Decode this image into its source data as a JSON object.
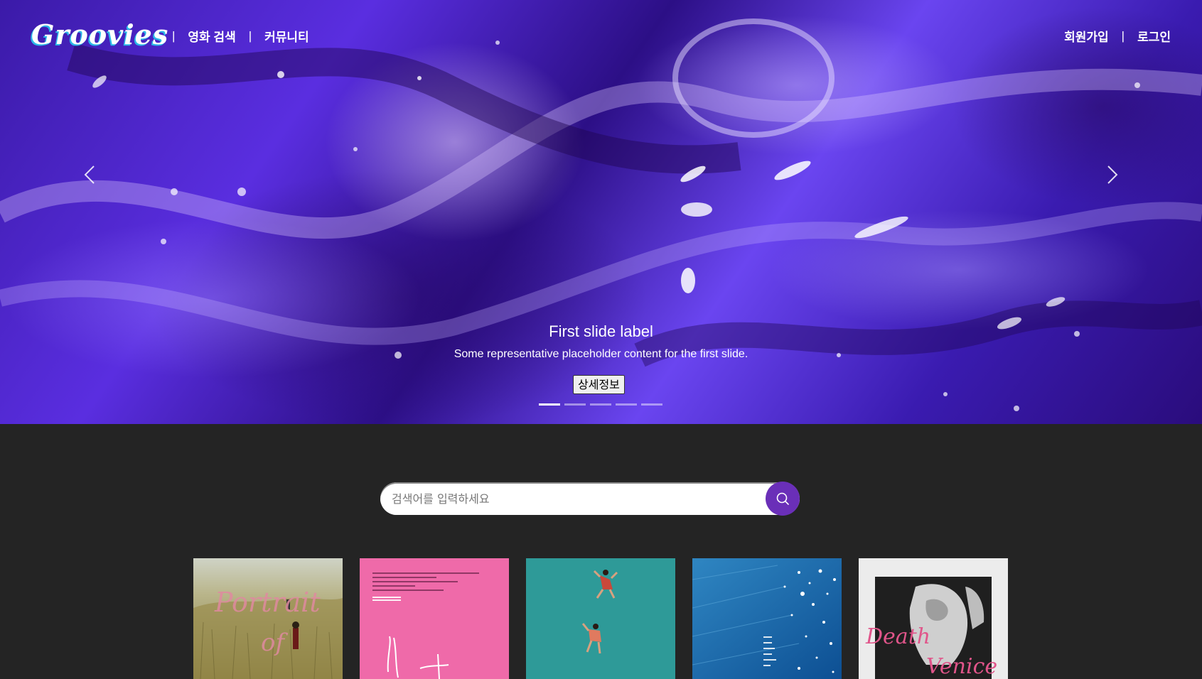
{
  "nav": {
    "logo": "Groovies",
    "left_links": [
      "영화 검색",
      "커뮤니티"
    ],
    "right_links": [
      "회원가입",
      "로그인"
    ],
    "separator": "|"
  },
  "carousel": {
    "slide_title": "First slide label",
    "slide_text": "Some representative placeholder content for the first slide.",
    "detail_button": "상세정보",
    "slide_count": 5,
    "active_index": 0,
    "accent": "#5a2ee0"
  },
  "search": {
    "placeholder": "검색어를 입력하세요",
    "button_color": "#6a2fb8"
  },
  "posters": [
    {
      "theme": "grass-field",
      "title_art": "Portrait of"
    },
    {
      "theme": "pink",
      "title_art": ""
    },
    {
      "theme": "teal-divers",
      "title_art": ""
    },
    {
      "theme": "blue-pool",
      "title_art": ""
    },
    {
      "theme": "statue-white",
      "title_art": "Death in Venice"
    }
  ],
  "colors": {
    "background": "#242424",
    "accent": "#6a2fb8"
  }
}
